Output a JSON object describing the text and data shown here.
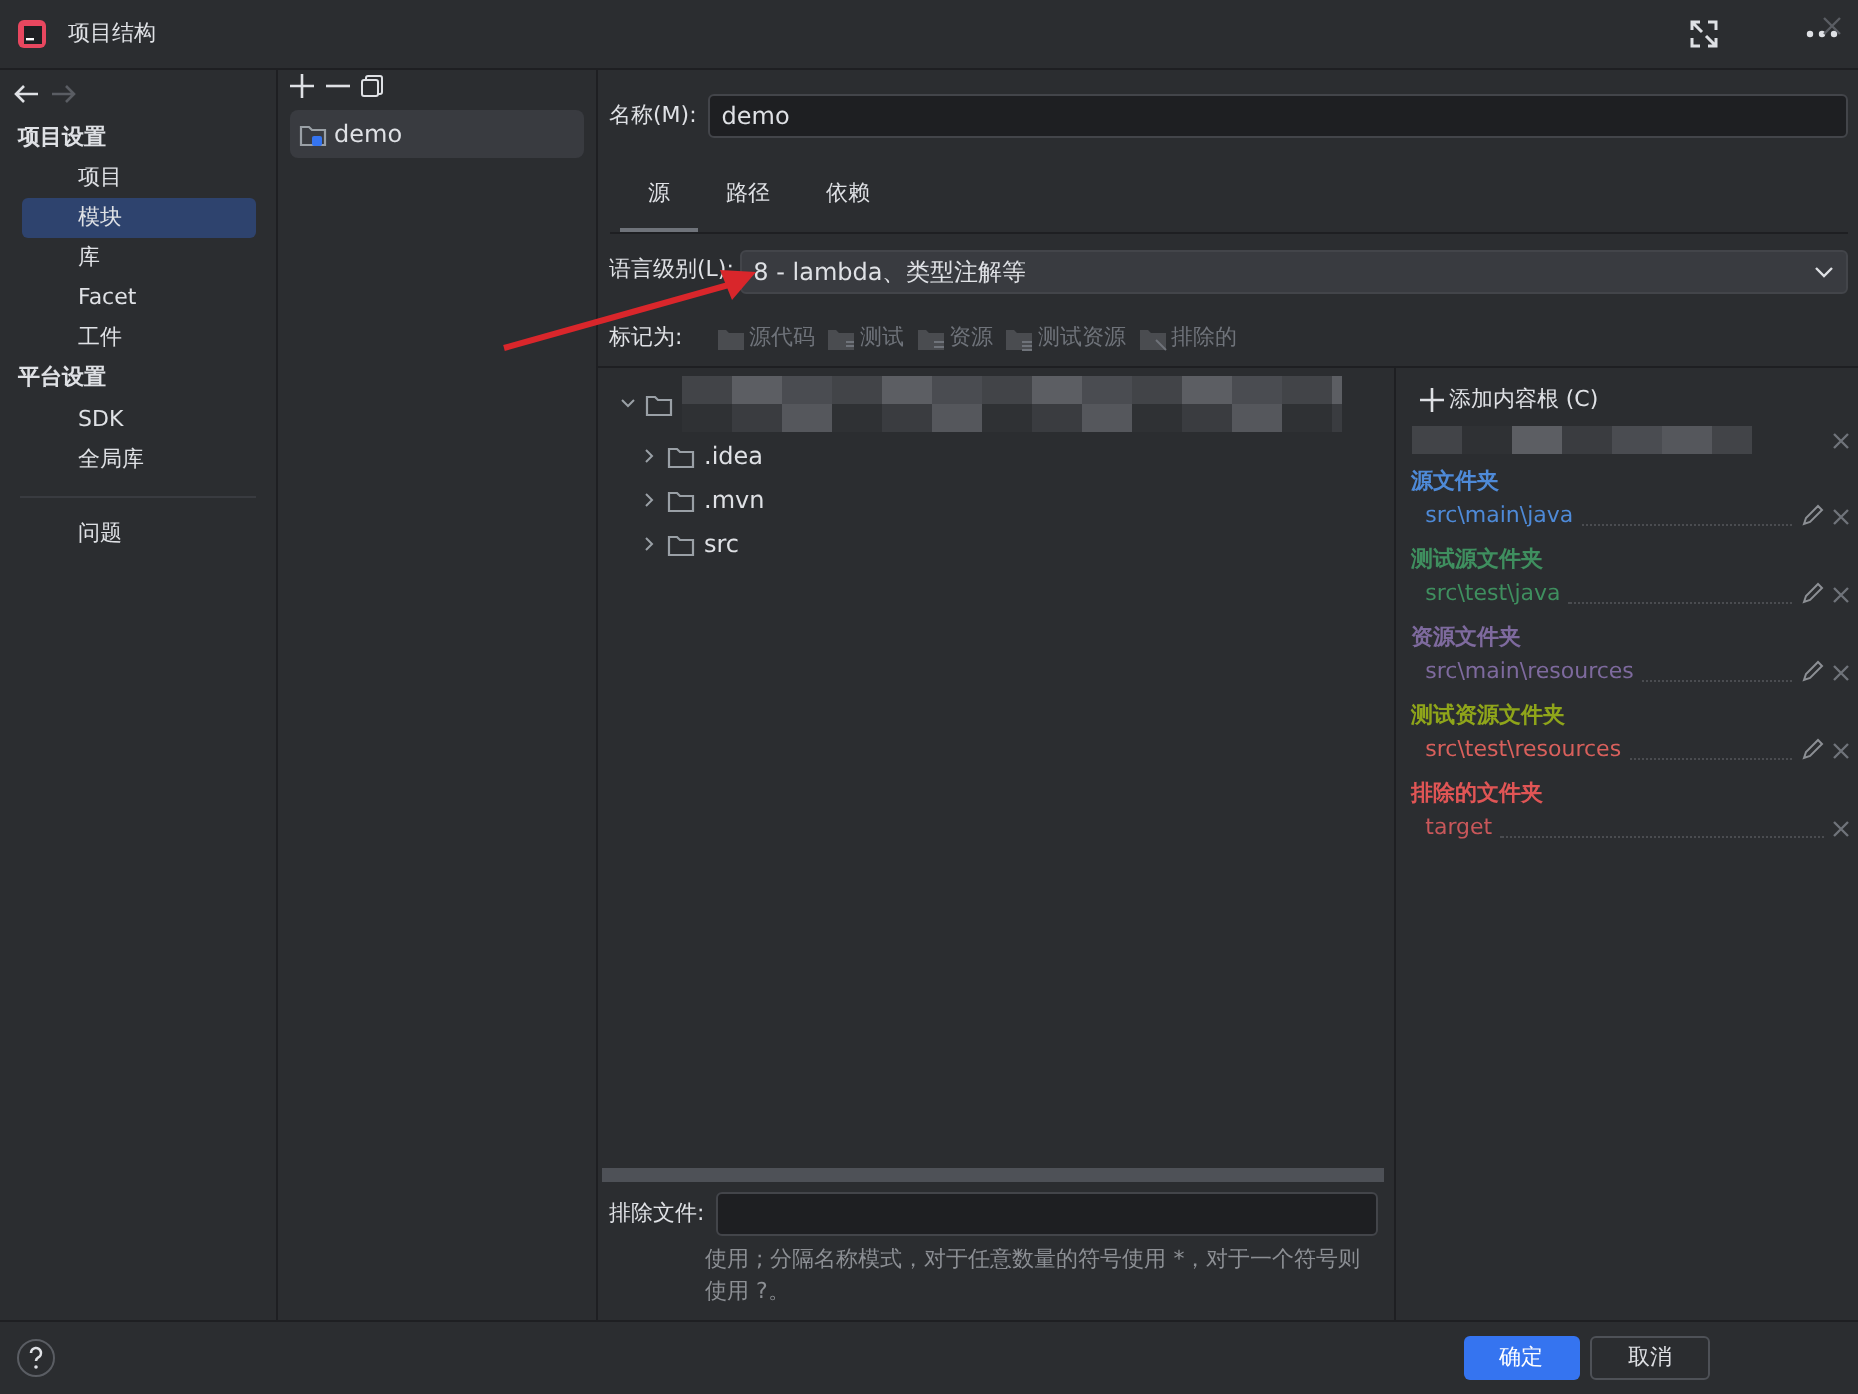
{
  "window": {
    "title": "项目结构"
  },
  "sidebar": {
    "groups": [
      {
        "title": "项目设置",
        "items": [
          {
            "label": "项目",
            "selected": false
          },
          {
            "label": "模块",
            "selected": true
          },
          {
            "label": "库",
            "selected": false
          },
          {
            "label": "Facet",
            "selected": false
          },
          {
            "label": "工件",
            "selected": false
          }
        ]
      },
      {
        "title": "平台设置",
        "items": [
          {
            "label": "SDK",
            "selected": false
          },
          {
            "label": "全局库",
            "selected": false
          }
        ]
      }
    ],
    "extra_items": [
      {
        "label": "问题",
        "selected": false
      }
    ]
  },
  "modules": {
    "items": [
      {
        "label": "demo",
        "selected": true
      }
    ]
  },
  "name_field": {
    "label": "名称(M):",
    "value": "demo"
  },
  "tabs": [
    {
      "label": "源",
      "selected": true
    },
    {
      "label": "路径",
      "selected": false
    },
    {
      "label": "依赖",
      "selected": false
    }
  ],
  "language_level": {
    "label": "语言级别(L):",
    "value": "8 - lambda、类型注解等"
  },
  "mark_as": {
    "label": "标记为:",
    "options": [
      {
        "label": "源代码",
        "kind": "source"
      },
      {
        "label": "测试",
        "kind": "test"
      },
      {
        "label": "资源",
        "kind": "resources"
      },
      {
        "label": "测试资源",
        "kind": "test-resources"
      },
      {
        "label": "排除的",
        "kind": "excluded"
      }
    ]
  },
  "tree": {
    "root": {
      "expanded": true,
      "children": [
        {
          "label": ".idea",
          "expanded": false
        },
        {
          "label": ".mvn",
          "expanded": false
        },
        {
          "label": "src",
          "expanded": false
        }
      ]
    }
  },
  "content_root": {
    "add_button": "添加内容根 (C)",
    "folders": [
      {
        "title": {
          "text": "源文件夹",
          "color": "#4e8ad8"
        },
        "path": {
          "text": "src\\main\\java",
          "color": "#4e8ad8"
        },
        "editable": true
      },
      {
        "title": {
          "text": "测试源文件夹",
          "color": "#3f8f5f"
        },
        "path": {
          "text": "src\\test\\java",
          "color": "#3f8f5f"
        },
        "editable": true
      },
      {
        "title": {
          "text": "资源文件夹",
          "color": "#7e6a9e"
        },
        "path": {
          "text": "src\\main\\resources",
          "color": "#7e6a9e"
        },
        "editable": true
      },
      {
        "title": {
          "text": "测试资源文件夹",
          "color": "#8fa51a"
        },
        "path": {
          "text": "src\\test\\resources",
          "color": "#d9605c"
        },
        "editable": true
      },
      {
        "title": {
          "text": "排除的文件夹",
          "color": "#e05555"
        },
        "path": {
          "text": "target",
          "color": "#c8575a"
        },
        "editable": false
      }
    ]
  },
  "exclude_files": {
    "label": "排除文件:",
    "hint": "使用 ; 分隔名称模式，对于任意数量的符号使用 *，对于一个符号则使用 ?。"
  },
  "buttons": [
    {
      "label": "确定",
      "kind": "primary"
    },
    {
      "label": "取消",
      "kind": "secondary"
    }
  ]
}
